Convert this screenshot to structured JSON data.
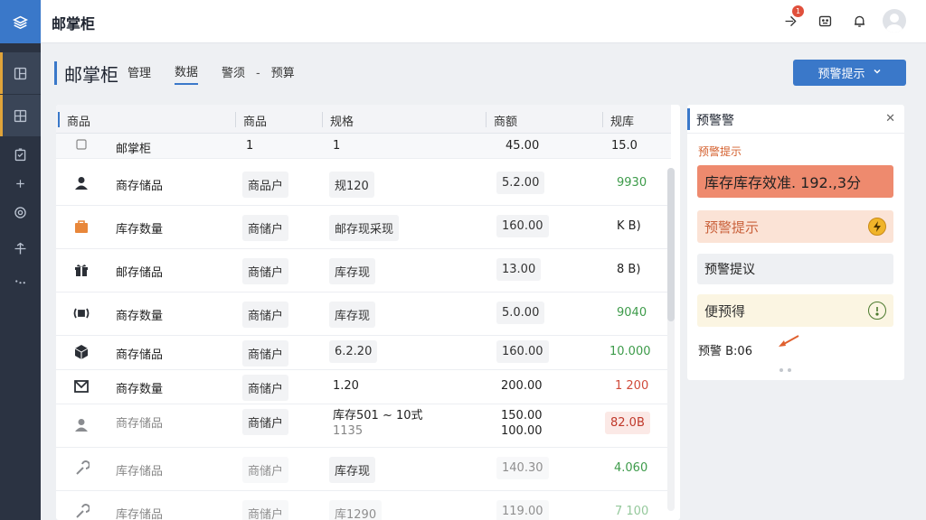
{
  "app": {
    "title": "邮掌柜"
  },
  "header": {
    "notification_count": "1"
  },
  "page": {
    "title": "邮掌柜",
    "tabs": [
      {
        "label": "管理",
        "active": false
      },
      {
        "label": "数据",
        "active": true
      },
      {
        "label": "警须",
        "active": false
      },
      {
        "label": "预算",
        "active": false
      }
    ],
    "tab_separator": "-",
    "primary_button": "预警提示"
  },
  "table": {
    "columns": [
      "商品",
      "商品",
      "规格",
      "商额",
      "规库"
    ],
    "header_row": {
      "name": "邮掌柜",
      "cat": "1",
      "spec": "1",
      "price": "45.00",
      "stock": "15.0"
    },
    "rows": [
      {
        "icon": "person-icon",
        "name": "商存储品",
        "cat": "商品户",
        "spec": "规120",
        "price": "5.2.00",
        "stock": "9930",
        "stock_color": "green"
      },
      {
        "icon": "box-icon",
        "name": "库存数量",
        "cat": "商储户",
        "spec": "邮存现采现",
        "price": "160.00",
        "stock": "K B)",
        "stock_color": "dark"
      },
      {
        "icon": "gift-icon",
        "name": "邮存储品",
        "cat": "商储户",
        "spec": "库存现",
        "price": "13.00",
        "stock": "8 B)",
        "stock_color": "dark"
      },
      {
        "icon": "scanner-icon",
        "name": "商存数量",
        "cat": "商储户",
        "spec": "库存现",
        "price": "5.0.00",
        "stock": "9040",
        "stock_color": "green"
      },
      {
        "icon": "cube-icon",
        "name": "商存储品",
        "cat": "商储户",
        "spec": "6.2.20",
        "price": "160.00",
        "stock": "10.000",
        "stock_color": "green"
      },
      {
        "icon": "envelope-icon",
        "name": "商存数量",
        "cat": "商储户",
        "spec": "1.20",
        "price": "200.00",
        "stock": "1 200",
        "stock_color": "red"
      },
      {
        "icon": "person-icon",
        "name": "商存储品",
        "cat": "商储户",
        "spec": "库存501 ~ 10式",
        "spec2": "1135",
        "price": "150.00",
        "price2": "100.00",
        "stock": "82.0B",
        "stock_color": "red-pill"
      },
      {
        "icon": "wrench-icon",
        "name": "库存储品",
        "cat": "商储户",
        "spec": "库存现",
        "price": "140.30",
        "stock": "4.060",
        "stock_color": "green"
      },
      {
        "icon": "wrench-icon",
        "name": "库存储品",
        "cat": "商储户",
        "spec": "库1290",
        "price": "119.00",
        "stock": "7 100",
        "stock_color": "green"
      }
    ]
  },
  "alerts": {
    "title": "预警警",
    "subtitle": "预警提示",
    "items": [
      {
        "text": "库存库存效准. 192.,3分"
      },
      {
        "text": "预警提示",
        "icon": "lightning-icon"
      },
      {
        "text": "预警提议"
      },
      {
        "text": "便预得",
        "icon": "clock-icon"
      }
    ],
    "footer": "预警 B:06"
  }
}
